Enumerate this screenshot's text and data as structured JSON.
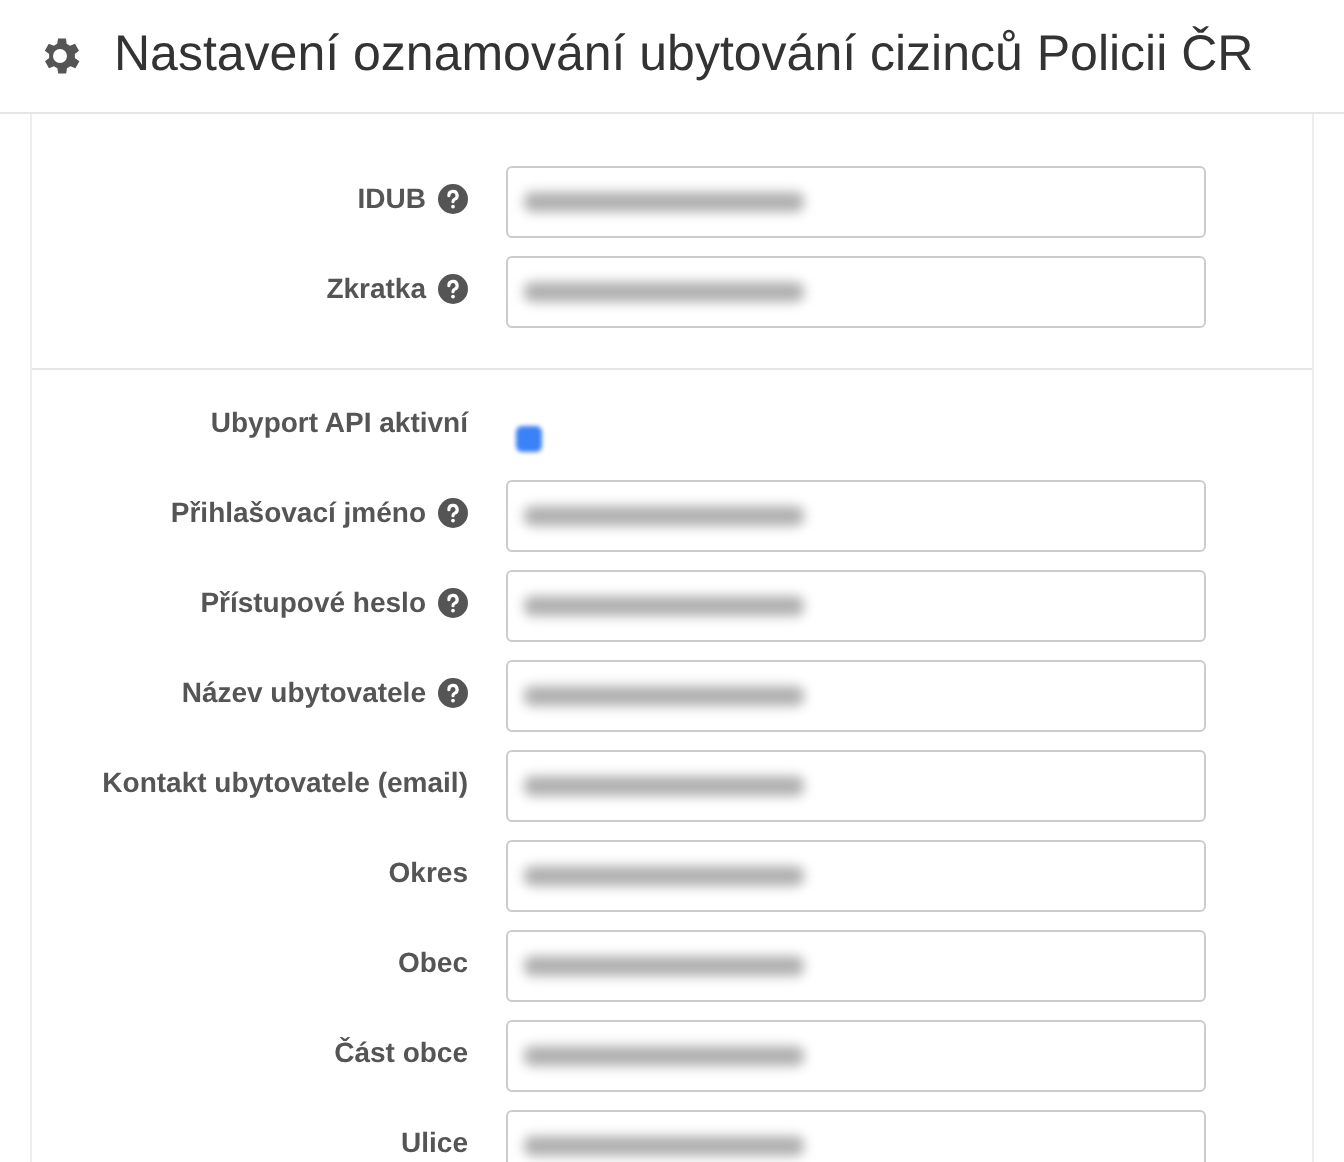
{
  "title": "Nastavení oznamování ubytování cizinců Policii ČR",
  "sections": [
    {
      "fields": [
        {
          "kind": "text",
          "label": "IDUB",
          "help": true
        },
        {
          "kind": "text",
          "label": "Zkratka",
          "help": true
        }
      ]
    },
    {
      "fields": [
        {
          "kind": "checkbox",
          "label": "Ubyport API aktivní",
          "help": false,
          "checked": true
        },
        {
          "kind": "text",
          "label": "Přihlašovací jméno",
          "help": true
        },
        {
          "kind": "text",
          "label": "Přístupové heslo",
          "help": true
        },
        {
          "kind": "text",
          "label": "Název ubytovatele",
          "help": true
        },
        {
          "kind": "text",
          "label": "Kontakt ubytovatele (email)",
          "help": false
        },
        {
          "kind": "text",
          "label": "Okres",
          "help": false
        },
        {
          "kind": "text",
          "label": "Obec",
          "help": false
        },
        {
          "kind": "text",
          "label": "Část obce",
          "help": false
        },
        {
          "kind": "text",
          "label": "Ulice",
          "help": false
        }
      ]
    }
  ]
}
